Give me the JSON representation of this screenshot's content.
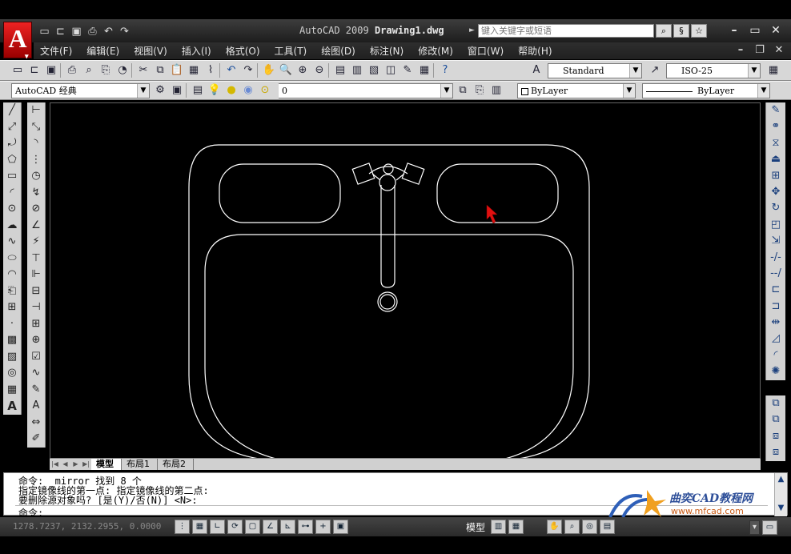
{
  "app": {
    "logo_letter": "A",
    "title_app": "AutoCAD 2009",
    "title_file": "Drawing1.dwg",
    "search_placeholder": "键入关键字或短语"
  },
  "quick_access": [
    "new-icon",
    "open-icon",
    "save-icon",
    "print-icon",
    "undo-icon",
    "redo-icon"
  ],
  "menu": {
    "items": [
      "文件(F)",
      "编辑(E)",
      "视图(V)",
      "插入(I)",
      "格式(O)",
      "工具(T)",
      "绘图(D)",
      "标注(N)",
      "修改(M)",
      "窗口(W)",
      "帮助(H)"
    ]
  },
  "toolbar": {
    "text_style": "Standard",
    "dim_style": "ISO-25",
    "workspace": "AutoCAD 经典",
    "layer": "0",
    "color": "ByLayer",
    "linetype": "ByLayer"
  },
  "layout_tabs": [
    "模型",
    "布局1",
    "布局2"
  ],
  "command": {
    "lines": [
      "命令: _mirror 找到 8 个",
      "指定镜像线的第一点: 指定镜像线的第二点:",
      "要删除源对象吗? [是(Y)/否(N)] <N>:"
    ],
    "prompt": "命令:"
  },
  "status": {
    "coords": "1278.7237, 2132.2955, 0.0000",
    "model_label": "模型"
  },
  "watermark": {
    "title": "曲奕CAD教程网",
    "url": "www.mfcad.com"
  },
  "colors": {
    "canvas_bg": "#000000",
    "drawing_line": "#ffffff",
    "cursor": "#e01010",
    "title_bar": "#2a2a2a",
    "toolbar": "#d7d7d7"
  }
}
